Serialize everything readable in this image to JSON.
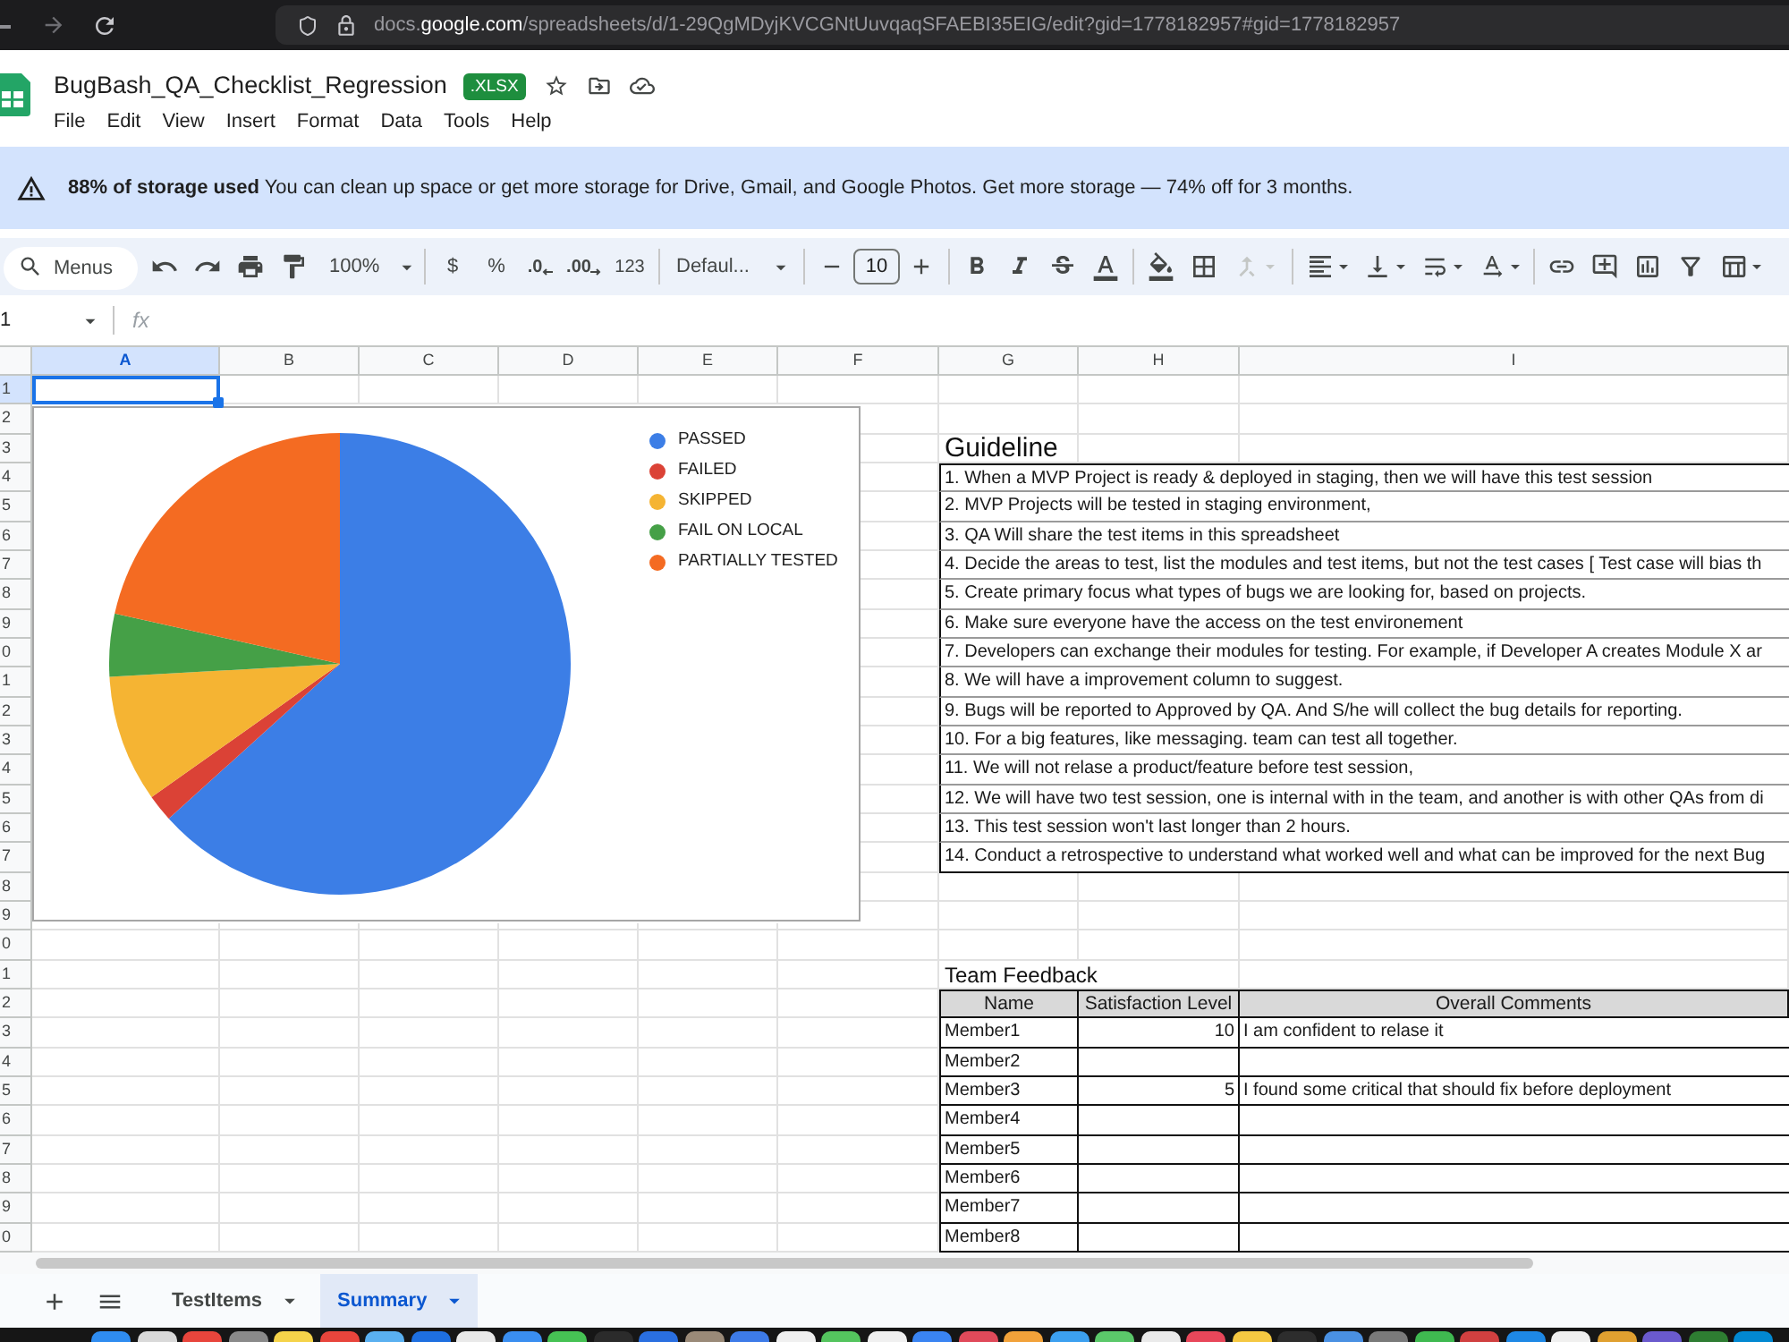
{
  "browser": {
    "url": {
      "subdomain": "docs.",
      "domain": "google.com",
      "path": "/spreadsheets/d/1-29QgMDyjKVCGNtUuvqaqSFAEBI35EIG/edit?gid=1778182957#gid=1778182957"
    }
  },
  "document": {
    "title": "BugBash_QA_Checklist_Regression",
    "badge": ".XLSX",
    "starred": false
  },
  "menu": [
    "File",
    "Edit",
    "View",
    "Insert",
    "Format",
    "Data",
    "Tools",
    "Help"
  ],
  "storage_banner": {
    "text": "**88% of storage used** You can clean up space or get more storage for Drive, Gmail, and Google Photos. Get more storage — 74% off for 3 months."
  },
  "toolbar": {
    "search": {
      "placeholder": "Menus"
    },
    "zoom": "100%",
    "currency": "$",
    "percent": "%",
    "decrease_decimal": ".0",
    "increase_decimal": ".00",
    "number_format": "123",
    "font": "Defaul...",
    "font_size": "10",
    "merge_disabled": true
  },
  "formula_bar": {
    "name_box": "1",
    "fx": "fx"
  },
  "columns": [
    {
      "label": "A",
      "selected": true
    },
    {
      "label": "B",
      "selected": false
    },
    {
      "label": "C",
      "selected": false
    },
    {
      "label": "D",
      "selected": false
    },
    {
      "label": "E",
      "selected": false
    },
    {
      "label": "F",
      "selected": false
    },
    {
      "label": "G",
      "selected": false
    },
    {
      "label": "H",
      "selected": false
    },
    {
      "label": "I",
      "selected": false
    }
  ],
  "rows": [
    {
      "label": "1",
      "selected": true
    },
    {
      "label": "2",
      "selected": false
    },
    {
      "label": "3",
      "selected": false
    },
    {
      "label": "4",
      "selected": false
    },
    {
      "label": "5",
      "selected": false
    },
    {
      "label": "6",
      "selected": false
    },
    {
      "label": "7",
      "selected": false
    },
    {
      "label": "8",
      "selected": false
    },
    {
      "label": "9",
      "selected": false
    },
    {
      "label": "0",
      "selected": false
    },
    {
      "label": "1",
      "selected": false
    },
    {
      "label": "2",
      "selected": false
    },
    {
      "label": "3",
      "selected": false
    },
    {
      "label": "4",
      "selected": false
    },
    {
      "label": "5",
      "selected": false
    },
    {
      "label": "6",
      "selected": false
    },
    {
      "label": "7",
      "selected": false
    },
    {
      "label": "8",
      "selected": false
    },
    {
      "label": "9",
      "selected": false
    },
    {
      "label": "0",
      "selected": false
    },
    {
      "label": "1",
      "selected": false
    },
    {
      "label": "2",
      "selected": false
    },
    {
      "label": "3",
      "selected": false
    },
    {
      "label": "4",
      "selected": false
    },
    {
      "label": "5",
      "selected": false
    },
    {
      "label": "6",
      "selected": false
    },
    {
      "label": "7",
      "selected": false
    },
    {
      "label": "8",
      "selected": false
    },
    {
      "label": "9",
      "selected": false
    },
    {
      "label": "0",
      "selected": false
    }
  ],
  "chart": {
    "legend": [
      {
        "label": "PASSED",
        "color": "#3c7ee6"
      },
      {
        "label": "FAILED",
        "color": "#db4236"
      },
      {
        "label": "SKIPPED",
        "color": "#f5b433"
      },
      {
        "label": "FAIL ON LOCAL",
        "color": "#45a047"
      },
      {
        "label": "PARTIALLY TESTED",
        "color": "#f46b22"
      }
    ]
  },
  "guideline": {
    "title": "Guideline",
    "items": [
      "1. When a MVP Project is ready & deployed in staging, then we will have this test session",
      "2. MVP Projects will be tested in staging environment,",
      "3. QA Will share the test items in this spreadsheet",
      "4. Decide the areas to test, list the modules and test items, but not the test cases [ Test case will bias th",
      "5. Create primary focus what types of bugs we are looking for, based on projects.",
      "6. Make sure everyone have the access on the test environement",
      "7. Developers can exchange their modules for testing. For example, if Developer A creates Module X ar",
      "8. We will have a improvement column to suggest.",
      "9. Bugs will be reported to Approved by QA. And S/he will collect the bug details for reporting.",
      "10. For a big features, like messaging. team can test all together.",
      "11. We will not relase a product/feature before test session,",
      "12. We will have two test session, one is internal with in the team, and another is with other QAs from di",
      "13. This test session won't last longer than 2 hours.",
      "14. Conduct a retrospective to understand what worked well and what can be improved for the next Bug"
    ]
  },
  "team_feedback": {
    "title": "Team Feedback",
    "columns": [
      "Name",
      "Satisfaction Level",
      "Overall Comments"
    ],
    "rows": [
      {
        "name": "Member1",
        "satisfaction": "10",
        "comment": "I am confident to relase it"
      },
      {
        "name": "Member2"
      },
      {
        "name": "Member3",
        "satisfaction": "5",
        "comment": "I found some critical that should fix before deployment"
      },
      {
        "name": "Member4"
      },
      {
        "name": "Member5"
      },
      {
        "name": "Member6"
      },
      {
        "name": "Member7"
      },
      {
        "name": "Member8"
      }
    ]
  },
  "sheet_tabs": [
    {
      "label": "TestItems",
      "selected": false
    },
    {
      "label": "Summary",
      "selected": true
    }
  ]
}
